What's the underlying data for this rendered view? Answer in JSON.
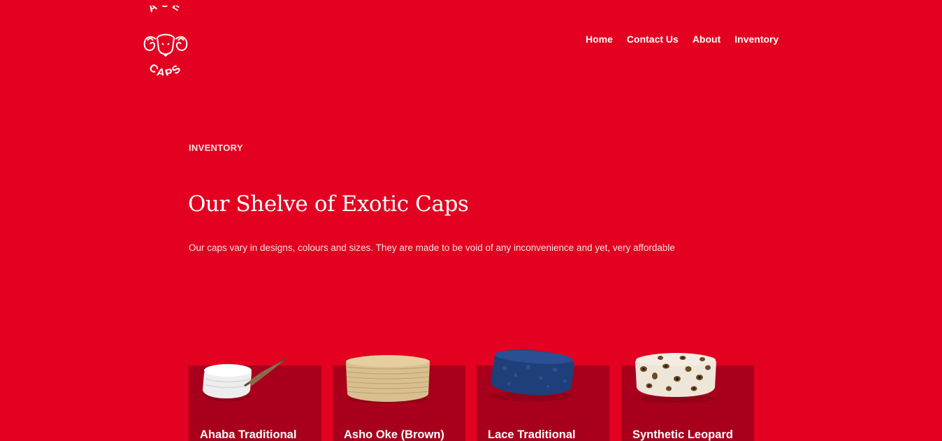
{
  "brand": {
    "logo_top": "ACE",
    "logo_bottom": "CAPS"
  },
  "nav": {
    "items": [
      {
        "label": "Home"
      },
      {
        "label": "Contact Us"
      },
      {
        "label": "About"
      },
      {
        "label": "Inventory"
      }
    ]
  },
  "hero": {
    "eyebrow": "INVENTORY",
    "title": "Our Shelve of Exotic Caps",
    "description": "Our caps vary in designs, colours and sizes. They are made to be void of any inconvenience and yet, very affordable"
  },
  "products": [
    {
      "title": "Ahaba Traditional",
      "image": "white-cap-with-feather"
    },
    {
      "title": "Asho Oke (Brown)",
      "image": "beige-woven-cap"
    },
    {
      "title": "Lace Traditional",
      "image": "blue-lace-cap"
    },
    {
      "title": "Synthetic Leopard",
      "image": "leopard-print-cap"
    }
  ],
  "colors": {
    "background": "#e30020",
    "card": "#a8001c",
    "text": "#ffffff"
  }
}
